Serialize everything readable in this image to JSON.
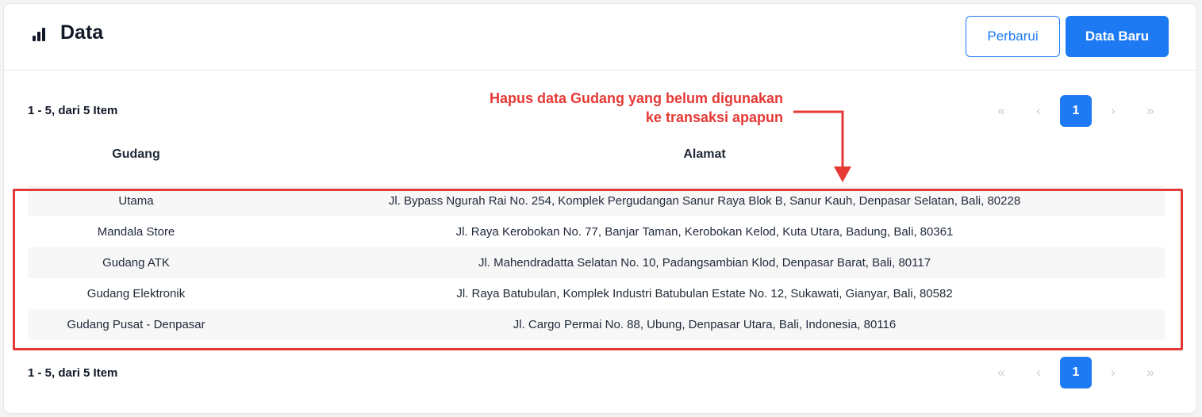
{
  "header": {
    "title": "Data",
    "title_icon": "bar-chart-icon",
    "refresh_label": "Perbarui",
    "new_label": "Data Baru"
  },
  "summary_top": "1 - 5, dari 5 Item",
  "summary_bottom": "1 - 5, dari 5 Item",
  "pagination": {
    "first": "«",
    "prev": "‹",
    "current": "1",
    "next": "›",
    "last": "»"
  },
  "annotation": {
    "line1": "Hapus data Gudang yang belum digunakan",
    "line2": "ke transaksi apapun",
    "color": "#e53935"
  },
  "table": {
    "columns": [
      "Gudang",
      "Alamat"
    ],
    "rows": [
      {
        "gudang": "Utama",
        "alamat": "Jl. Bypass Ngurah Rai No. 254, Komplek Pergudangan Sanur Raya Blok B, Sanur Kauh, Denpasar Selatan, Bali, 80228"
      },
      {
        "gudang": "Mandala Store",
        "alamat": "Jl. Raya Kerobokan No. 77, Banjar Taman, Kerobokan Kelod, Kuta Utara, Badung, Bali, 80361"
      },
      {
        "gudang": "Gudang ATK",
        "alamat": "Jl. Mahendradatta Selatan No. 10, Padangsambian Klod, Denpasar Barat, Bali, 80117"
      },
      {
        "gudang": "Gudang Elektronik",
        "alamat": "Jl. Raya Batubulan, Komplek Industri Batubulan Estate No. 12, Sukawati, Gianyar, Bali, 80582"
      },
      {
        "gudang": "Gudang Pusat - Denpasar",
        "alamat": "Jl. Cargo Permai No. 88, Ubung, Denpasar Utara, Bali, Indonesia, 80116"
      }
    ]
  },
  "colors": {
    "primary": "#1d7af3",
    "highlight": "#e53935"
  }
}
